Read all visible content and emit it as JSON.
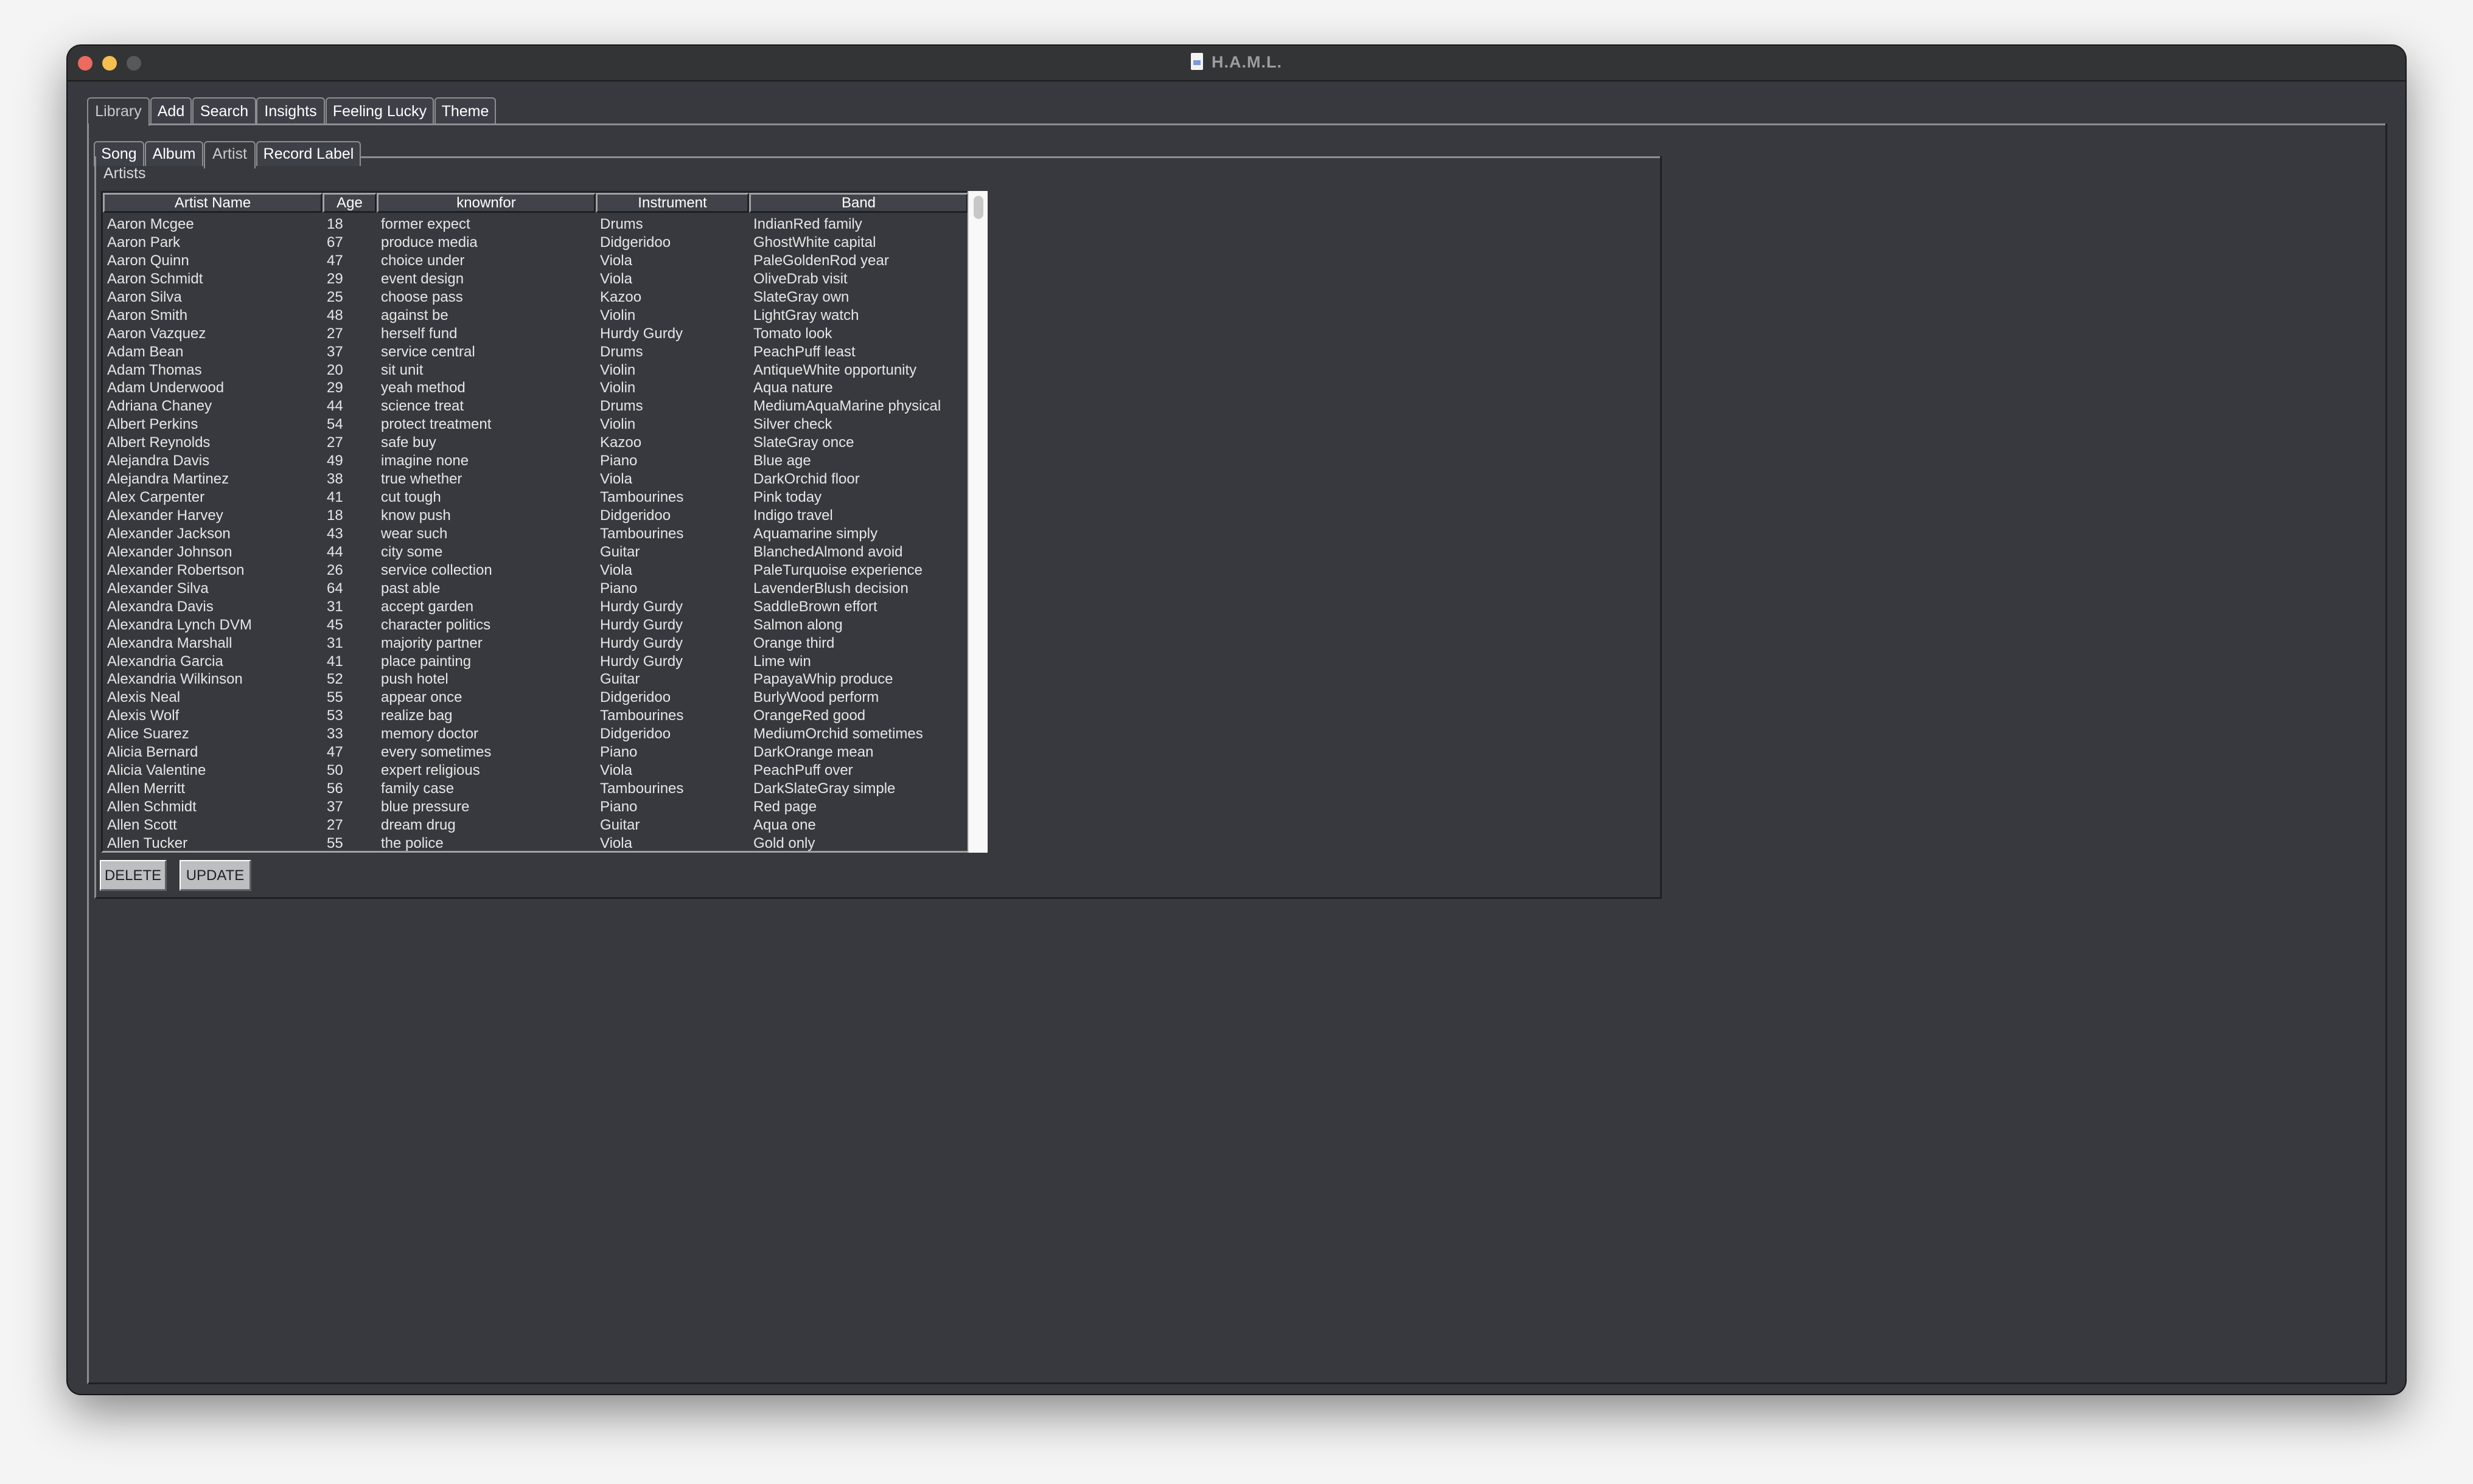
{
  "window": {
    "title": "H.A.M.L.",
    "title_icon": "document-icon"
  },
  "main_tabs": [
    {
      "label": "Library",
      "selected": true
    },
    {
      "label": "Add",
      "selected": false
    },
    {
      "label": "Search",
      "selected": false
    },
    {
      "label": "Insights",
      "selected": false
    },
    {
      "label": "Feeling Lucky",
      "selected": false
    },
    {
      "label": "Theme",
      "selected": false
    }
  ],
  "sub_tabs": [
    {
      "label": "Song",
      "selected": false
    },
    {
      "label": "Album",
      "selected": false
    },
    {
      "label": "Artist",
      "selected": true
    },
    {
      "label": "Record Label",
      "selected": false
    }
  ],
  "panel": {
    "label": "Artists",
    "columns": [
      "Artist Name",
      "Age",
      "knownfor",
      "Instrument",
      "Band"
    ],
    "rows": [
      [
        "Aaron Mcgee",
        "18",
        "former expect",
        "Drums",
        "IndianRed family"
      ],
      [
        "Aaron Park",
        "67",
        "produce media",
        "Didgeridoo",
        "GhostWhite capital"
      ],
      [
        "Aaron Quinn",
        "47",
        "choice under",
        "Viola",
        "PaleGoldenRod year"
      ],
      [
        "Aaron Schmidt",
        "29",
        "event design",
        "Viola",
        "OliveDrab visit"
      ],
      [
        "Aaron Silva",
        "25",
        "choose pass",
        "Kazoo",
        "SlateGray own"
      ],
      [
        "Aaron Smith",
        "48",
        "against be",
        "Violin",
        "LightGray watch"
      ],
      [
        "Aaron Vazquez",
        "27",
        "herself fund",
        "Hurdy Gurdy",
        "Tomato look"
      ],
      [
        "Adam Bean",
        "37",
        "service central",
        "Drums",
        "PeachPuff least"
      ],
      [
        "Adam Thomas",
        "20",
        "sit unit",
        "Violin",
        "AntiqueWhite opportunity"
      ],
      [
        "Adam Underwood",
        "29",
        "yeah method",
        "Violin",
        "Aqua nature"
      ],
      [
        "Adriana Chaney",
        "44",
        "science treat",
        "Drums",
        "MediumAquaMarine physical"
      ],
      [
        "Albert Perkins",
        "54",
        "protect treatment",
        "Violin",
        "Silver check"
      ],
      [
        "Albert Reynolds",
        "27",
        "safe buy",
        "Kazoo",
        "SlateGray once"
      ],
      [
        "Alejandra Davis",
        "49",
        "imagine none",
        "Piano",
        "Blue age"
      ],
      [
        "Alejandra Martinez",
        "38",
        "true whether",
        "Viola",
        "DarkOrchid floor"
      ],
      [
        "Alex Carpenter",
        "41",
        "cut tough",
        "Tambourines",
        "Pink today"
      ],
      [
        "Alexander Harvey",
        "18",
        "know push",
        "Didgeridoo",
        "Indigo travel"
      ],
      [
        "Alexander Jackson",
        "43",
        "wear such",
        "Tambourines",
        "Aquamarine simply"
      ],
      [
        "Alexander Johnson",
        "44",
        "city some",
        "Guitar",
        "BlanchedAlmond avoid"
      ],
      [
        "Alexander Robertson",
        "26",
        "service collection",
        "Viola",
        "PaleTurquoise experience"
      ],
      [
        "Alexander Silva",
        "64",
        "past able",
        "Piano",
        "LavenderBlush decision"
      ],
      [
        "Alexandra Davis",
        "31",
        "accept garden",
        "Hurdy Gurdy",
        "SaddleBrown effort"
      ],
      [
        "Alexandra Lynch DVM",
        "45",
        "character politics",
        "Hurdy Gurdy",
        "Salmon along"
      ],
      [
        "Alexandra Marshall",
        "31",
        "majority partner",
        "Hurdy Gurdy",
        "Orange third"
      ],
      [
        "Alexandria Garcia",
        "41",
        "place painting",
        "Hurdy Gurdy",
        "Lime win"
      ],
      [
        "Alexandria Wilkinson",
        "52",
        "push hotel",
        "Guitar",
        "PapayaWhip produce"
      ],
      [
        "Alexis Neal",
        "55",
        "appear once",
        "Didgeridoo",
        "BurlyWood perform"
      ],
      [
        "Alexis Wolf",
        "53",
        "realize bag",
        "Tambourines",
        "OrangeRed good"
      ],
      [
        "Alice Suarez",
        "33",
        "memory doctor",
        "Didgeridoo",
        "MediumOrchid sometimes"
      ],
      [
        "Alicia Bernard",
        "47",
        "every sometimes",
        "Piano",
        "DarkOrange mean"
      ],
      [
        "Alicia Valentine",
        "50",
        "expert religious",
        "Viola",
        "PeachPuff over"
      ],
      [
        "Allen Merritt",
        "56",
        "family case",
        "Tambourines",
        "DarkSlateGray simple"
      ],
      [
        "Allen Schmidt",
        "37",
        "blue pressure",
        "Piano",
        "Red page"
      ],
      [
        "Allen Scott",
        "27",
        "dream drug",
        "Guitar",
        "Aqua one"
      ],
      [
        "Allen Tucker",
        "55",
        "the police",
        "Viola",
        "Gold only"
      ]
    ],
    "buttons": {
      "delete": "DELETE",
      "update": "UPDATE"
    }
  },
  "colors": {
    "window_bg": "#38393e",
    "titlebar_bg": "#333435",
    "tab_bg": "#3e4048",
    "header_bg": "#41434b",
    "button_bg": "#bdbec1",
    "traffic_close": "#ec6a5e",
    "traffic_minimize": "#f4bf4f",
    "traffic_maximize": "#57585a"
  }
}
